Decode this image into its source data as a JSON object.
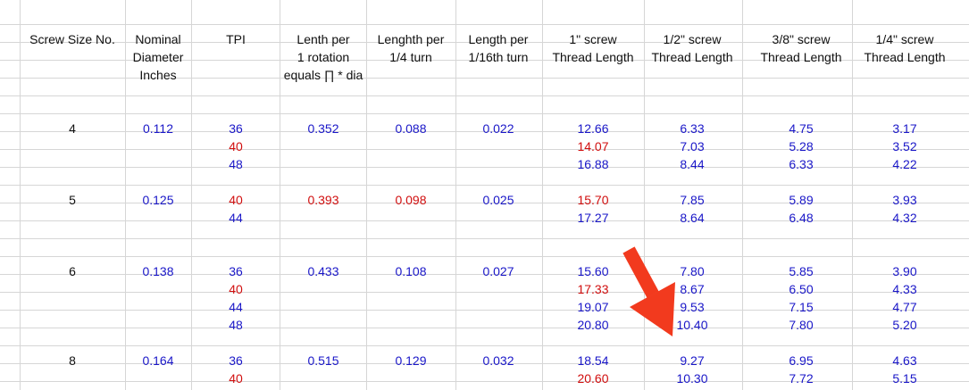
{
  "headers": [
    [
      "Screw Size No.",
      "",
      ""
    ],
    [
      "Nominal",
      "Diameter",
      "Inches"
    ],
    [
      "TPI",
      "",
      ""
    ],
    [
      "Lenth per",
      "1 rotation",
      "equals ∏ * dia"
    ],
    [
      "Lenghth per",
      "1/4 turn",
      ""
    ],
    [
      "Length per",
      "1/16th turn",
      ""
    ],
    [
      "1\" screw",
      "Thread Length",
      ""
    ],
    [
      "1/2\" screw",
      "Thread Length",
      ""
    ],
    [
      "3/8\" screw",
      "Thread Length",
      ""
    ],
    [
      "1/4\" screw",
      "Thread Length",
      ""
    ]
  ],
  "data_rows": [
    {
      "row": 6,
      "cells": [
        "4",
        "0.112",
        "36",
        "0.352",
        "0.088",
        "0.022",
        "12.66",
        "6.33",
        "4.75",
        "3.17"
      ],
      "colors": [
        "black",
        "blue",
        "blue",
        "blue",
        "blue",
        "blue",
        "blue",
        "blue",
        "blue",
        "blue"
      ]
    },
    {
      "row": 7,
      "cells": [
        "",
        "",
        "40",
        "",
        "",
        "",
        "14.07",
        "7.03",
        "5.28",
        "3.52"
      ],
      "colors": [
        "black",
        "blue",
        "red",
        "blue",
        "blue",
        "blue",
        "red",
        "blue",
        "blue",
        "blue"
      ]
    },
    {
      "row": 8,
      "cells": [
        "",
        "",
        "48",
        "",
        "",
        "",
        "16.88",
        "8.44",
        "6.33",
        "4.22"
      ],
      "colors": [
        "black",
        "blue",
        "blue",
        "blue",
        "blue",
        "blue",
        "blue",
        "blue",
        "blue",
        "blue"
      ]
    },
    {
      "row": 10,
      "cells": [
        "5",
        "0.125",
        "40",
        "0.393",
        "0.098",
        "0.025",
        "15.70",
        "7.85",
        "5.89",
        "3.93"
      ],
      "colors": [
        "black",
        "blue",
        "red",
        "red",
        "red",
        "blue",
        "red",
        "blue",
        "blue",
        "blue"
      ]
    },
    {
      "row": 11,
      "cells": [
        "",
        "",
        "44",
        "",
        "",
        "",
        "17.27",
        "8.64",
        "6.48",
        "4.32"
      ],
      "colors": [
        "black",
        "blue",
        "blue",
        "blue",
        "blue",
        "blue",
        "blue",
        "blue",
        "blue",
        "blue"
      ]
    },
    {
      "row": 14,
      "cells": [
        "6",
        "0.138",
        "36",
        "0.433",
        "0.108",
        "0.027",
        "15.60",
        "7.80",
        "5.85",
        "3.90"
      ],
      "colors": [
        "black",
        "blue",
        "blue",
        "blue",
        "blue",
        "blue",
        "blue",
        "blue",
        "blue",
        "blue"
      ]
    },
    {
      "row": 15,
      "cells": [
        "",
        "",
        "40",
        "",
        "",
        "",
        "17.33",
        "8.67",
        "6.50",
        "4.33"
      ],
      "colors": [
        "black",
        "blue",
        "red",
        "blue",
        "blue",
        "blue",
        "red",
        "blue",
        "blue",
        "blue"
      ]
    },
    {
      "row": 16,
      "cells": [
        "",
        "",
        "44",
        "",
        "",
        "",
        "19.07",
        "9.53",
        "7.15",
        "4.77"
      ],
      "colors": [
        "black",
        "blue",
        "blue",
        "blue",
        "blue",
        "blue",
        "blue",
        "blue",
        "blue",
        "blue"
      ]
    },
    {
      "row": 17,
      "cells": [
        "",
        "",
        "48",
        "",
        "",
        "",
        "20.80",
        "10.40",
        "7.80",
        "5.20"
      ],
      "colors": [
        "black",
        "blue",
        "blue",
        "blue",
        "blue",
        "blue",
        "blue",
        "blue",
        "blue",
        "blue"
      ]
    },
    {
      "row": 19,
      "cells": [
        "8",
        "0.164",
        "36",
        "0.515",
        "0.129",
        "0.032",
        "18.54",
        "9.27",
        "6.95",
        "4.63"
      ],
      "colors": [
        "black",
        "blue",
        "blue",
        "blue",
        "blue",
        "blue",
        "blue",
        "blue",
        "blue",
        "blue"
      ]
    },
    {
      "row": 20,
      "cells": [
        "",
        "",
        "40",
        "",
        "",
        "",
        "20.60",
        "10.30",
        "7.72",
        "5.15"
      ],
      "colors": [
        "black",
        "blue",
        "red",
        "blue",
        "blue",
        "blue",
        "red",
        "blue",
        "blue",
        "blue"
      ]
    }
  ],
  "colors": {
    "blue": "#1a17c8",
    "red": "#d10f0f",
    "black": "#111111",
    "gridline": "#d6d6d6",
    "arrow": "#f23a1e"
  },
  "annotation": {
    "icon": "red-arrow-icon",
    "points_to_value": "9.27"
  }
}
